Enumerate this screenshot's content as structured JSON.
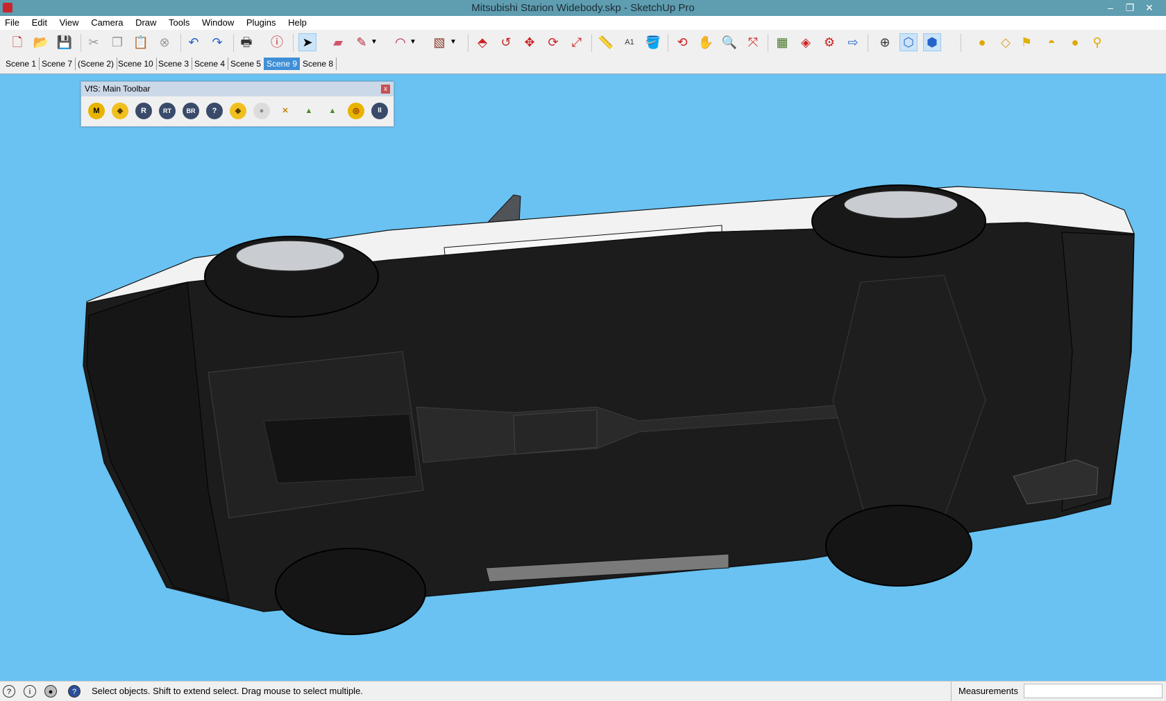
{
  "window": {
    "title": "Mitsubishi Starion Widebody.skp - SketchUp Pro"
  },
  "menu": [
    "File",
    "Edit",
    "View",
    "Camera",
    "Draw",
    "Tools",
    "Window",
    "Plugins",
    "Help"
  ],
  "toolbar": {
    "icons": [
      "new-icon",
      "open-icon",
      "save-icon",
      "cut-icon",
      "copy-icon",
      "paste-icon",
      "erase-icon",
      "undo-icon",
      "redo-icon",
      "print-icon",
      "model-info-icon",
      "select-icon",
      "eraser-icon",
      "pencil-icon",
      "arc-icon",
      "rectangle-icon",
      "push-pull-icon",
      "follow-me-icon",
      "move-icon",
      "rotate-icon",
      "scale-icon",
      "tape-measure-icon",
      "text-icon",
      "paint-bucket-icon",
      "orbit-icon",
      "pan-icon",
      "zoom-icon",
      "zoom-extents-icon",
      "components-icon",
      "materials-icon",
      "styles-icon",
      "export-icon",
      "position-camera-icon",
      "iso-view-icon",
      "top-view-icon",
      "sun-icon",
      "section-plane-icon",
      "flag-icon",
      "dome-icon",
      "sphere-icon",
      "pin-icon"
    ],
    "active": [
      "select-icon",
      "iso-view-icon",
      "top-view-icon"
    ]
  },
  "scenes": {
    "tabs": [
      "Scene 1",
      "Scene 7",
      "(Scene 2)",
      "Scene 10",
      "Scene 3",
      "Scene 4",
      "Scene 5",
      "Scene 9",
      "Scene 8"
    ],
    "active": "Scene 9"
  },
  "vfs_toolbar": {
    "title": "VfS: Main Toolbar",
    "close": "x",
    "buttons": [
      "M",
      "◆",
      "R",
      "RT",
      "BR",
      "?",
      "◆",
      "●",
      "✕",
      "▲",
      "▲",
      "◎",
      "II"
    ]
  },
  "statusbar": {
    "message": "Select objects. Shift to extend select. Drag mouse to select multiple.",
    "measurements_label": "Measurements",
    "measurements_value": ""
  },
  "colors": {
    "titlebar": "#5f9db1",
    "viewport_bg": "#69c2f2",
    "active_scene": "#3f8fd6"
  }
}
